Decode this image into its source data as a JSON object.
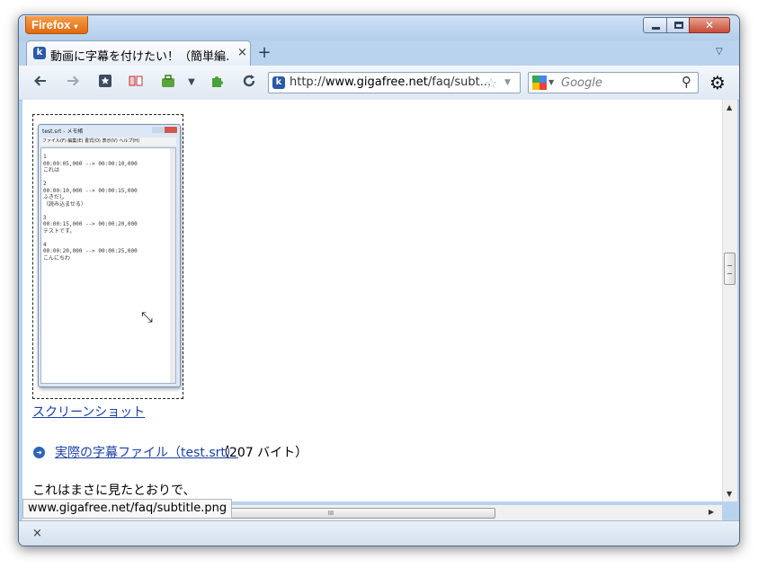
{
  "titlebar": {
    "app_button_label": "Firefox",
    "app_button_arrow": "▾",
    "close_glyph": "✕"
  },
  "tabs": [
    {
      "title": "動画に字幕を付けたい！（簡単編…",
      "close_glyph": "×",
      "favicon_glyph": "k"
    }
  ],
  "tabstrip": {
    "new_tab_glyph": "+",
    "list_all_glyph": "▽"
  },
  "navbar": {
    "back_icon": "arrow-left-icon",
    "forward_icon": "arrow-right-icon",
    "url_host": "www.gigafree.net",
    "url_prefix": "http://",
    "url_path": "/faq/subt...",
    "search_placeholder": "Google",
    "site_favicon_glyph": "k"
  },
  "content": {
    "notepad": {
      "title": "test.srt - メモ帳",
      "menu": "ファイル(F)  編集(E)  書式(O)  表示(V)  ヘルプ(H)",
      "text": "1\n00:00:05,000 --> 00:00:10,000\nこれは\n\n2\n00:00:10,000 --> 00:00:15,000\nふきだし\n（読み込ませる）\n\n3\n00:00:15,000 --> 00:00:20,000\nテストです。\n\n4\n00:00:20,000 --> 00:00:25,000\nこんにちわ"
    },
    "caption_link": "スクリーンショット",
    "srt_link": "実際の字幕ファイル（test.srt）",
    "srt_size": "（207 バイト）",
    "body_text": "これはまさに見たとおりで、"
  },
  "scrollbar": {
    "hthumb_grip": "III"
  },
  "status": {
    "link_url": "www.gigafree.net/faq/subtitle.png"
  },
  "addonbar": {
    "close_glyph": "×"
  }
}
